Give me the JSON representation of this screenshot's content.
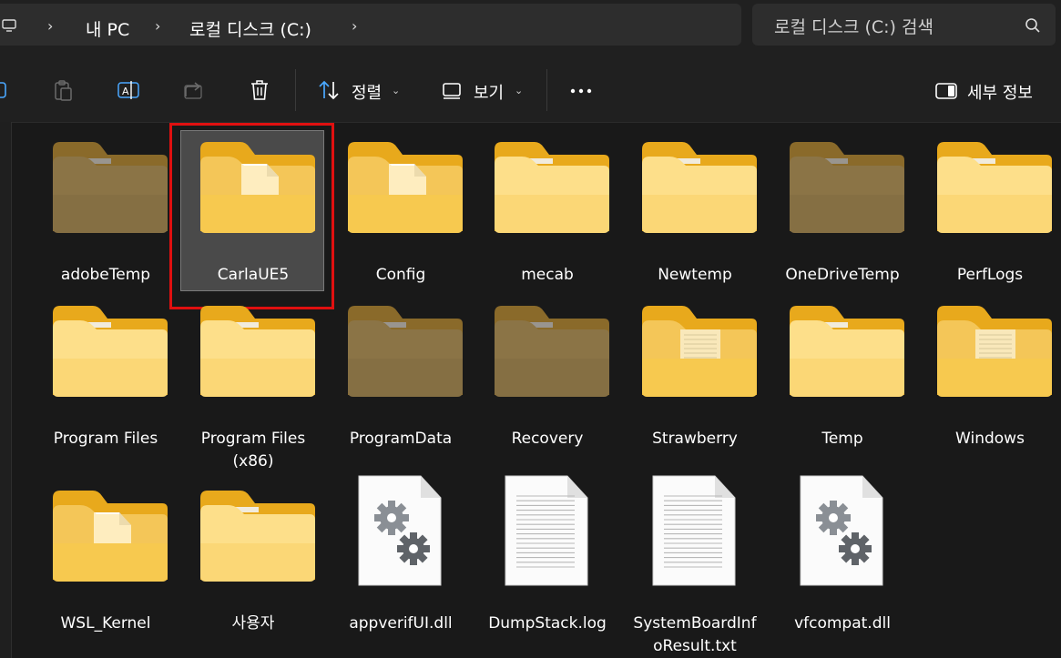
{
  "address": {
    "crumbs": [
      "내 PC",
      "로컬 디스크 (C:)"
    ],
    "search_placeholder": "로컬 디스크 (C:) 검색"
  },
  "toolbar": {
    "sort_label": "정렬",
    "view_label": "보기",
    "details_label": "세부 정보"
  },
  "items": [
    {
      "name": "adobeTemp",
      "type": "folder-dim"
    },
    {
      "name": "CarlaUE5",
      "type": "folder-doc",
      "selected": true
    },
    {
      "name": "Config",
      "type": "folder-doc"
    },
    {
      "name": "mecab",
      "type": "folder"
    },
    {
      "name": "Newtemp",
      "type": "folder"
    },
    {
      "name": "OneDriveTemp",
      "type": "folder-dim"
    },
    {
      "name": "PerfLogs",
      "type": "folder"
    },
    {
      "name": "Program Files",
      "type": "folder"
    },
    {
      "name": "Program Files (x86)",
      "type": "folder"
    },
    {
      "name": "ProgramData",
      "type": "folder-dim"
    },
    {
      "name": "Recovery",
      "type": "folder-dim"
    },
    {
      "name": "Strawberry",
      "type": "folder-text"
    },
    {
      "name": "Temp",
      "type": "folder"
    },
    {
      "name": "Windows",
      "type": "folder-text"
    },
    {
      "name": "WSL_Kernel",
      "type": "folder-doc"
    },
    {
      "name": "사용자",
      "type": "folder"
    },
    {
      "name": "appverifUI.dll",
      "type": "dll"
    },
    {
      "name": "DumpStack.log",
      "type": "txt"
    },
    {
      "name": "SystemBoardInfoResult.txt",
      "type": "txt"
    },
    {
      "name": "vfcompat.dll",
      "type": "dll"
    }
  ]
}
